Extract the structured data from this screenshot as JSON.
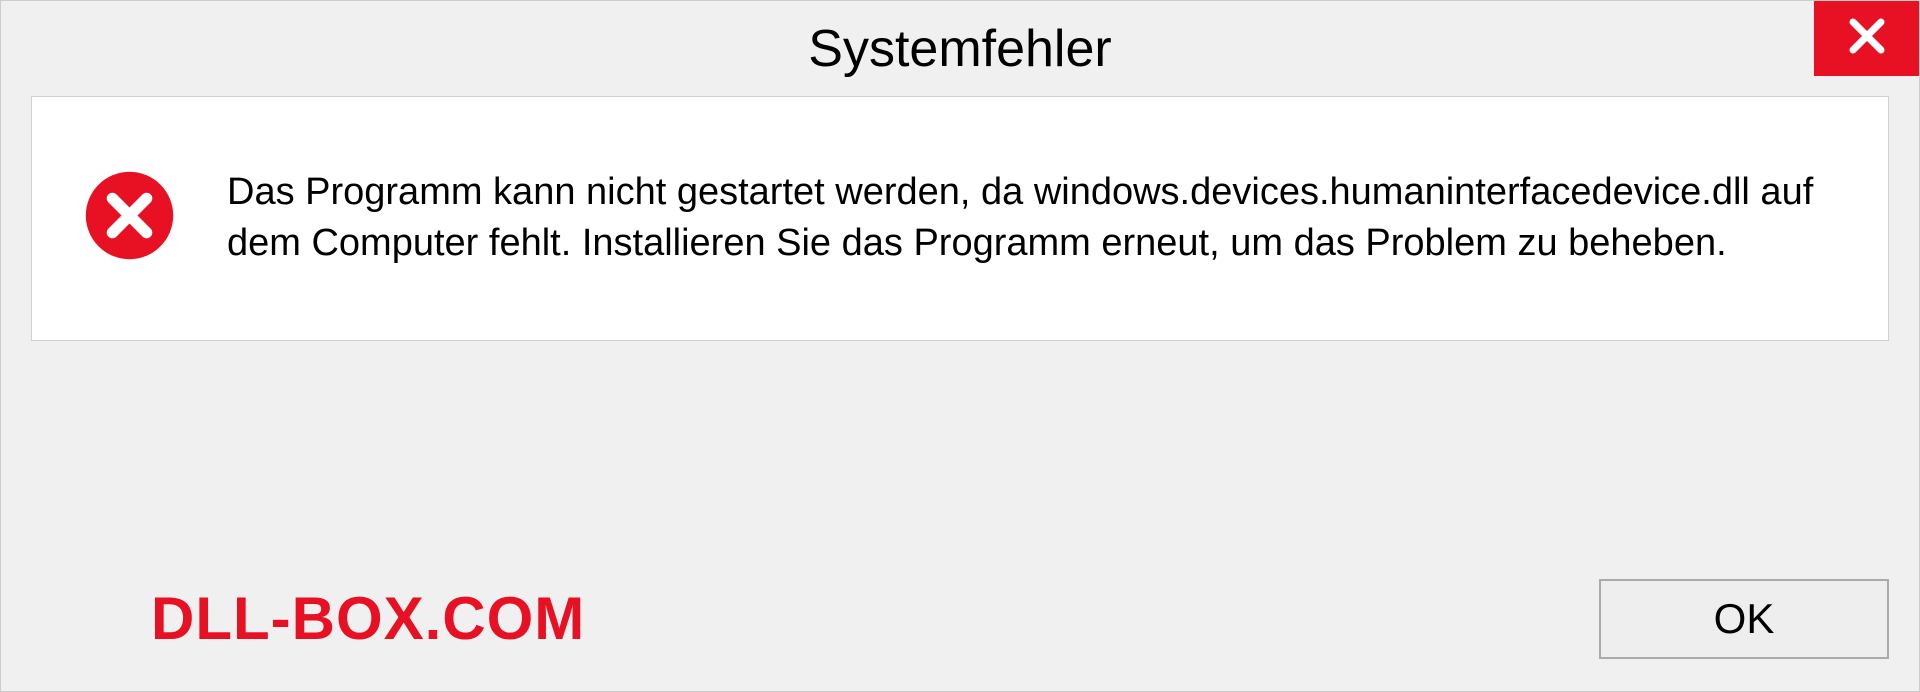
{
  "dialog": {
    "title": "Systemfehler",
    "message": "Das Programm kann nicht gestartet werden, da windows.devices.humaninterfacedevice.dll auf dem Computer fehlt. Installieren Sie das Programm erneut, um das Problem zu beheben.",
    "ok_label": "OK"
  },
  "watermark": "DLL-BOX.COM",
  "colors": {
    "accent": "#e81123"
  }
}
